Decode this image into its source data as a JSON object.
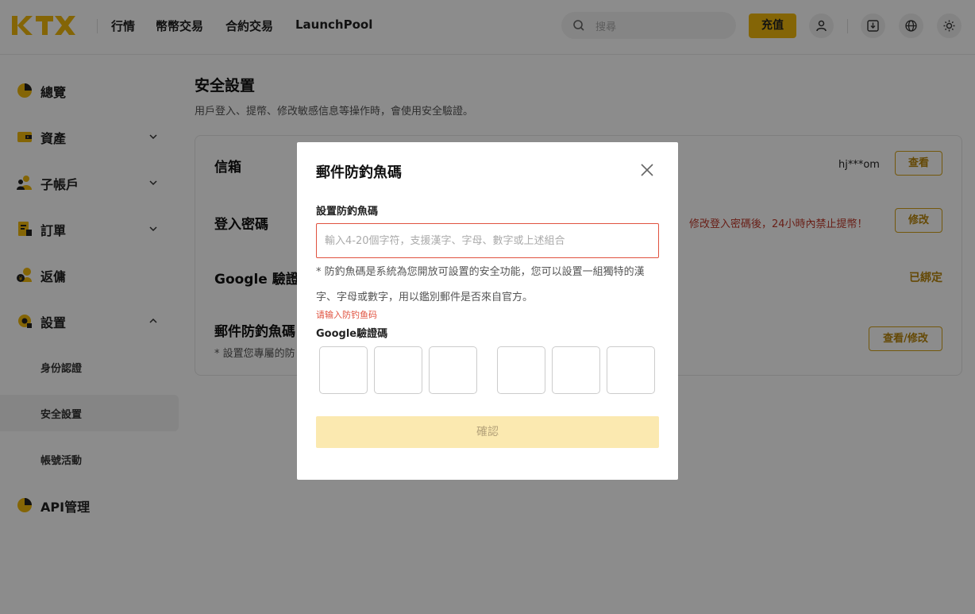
{
  "header": {
    "logo_text": "KTX",
    "nav": [
      "行情",
      "幣幣交易",
      "合約交易",
      "LaunchPool"
    ],
    "search_placeholder": "搜尋",
    "deposit_label": "充值",
    "icons": [
      "user-icon",
      "download-icon",
      "globe-icon",
      "theme-sun-icon"
    ]
  },
  "sidebar": {
    "items": [
      {
        "label": "總覽",
        "icon": "overview-icon"
      },
      {
        "label": "資產",
        "icon": "wallet-icon"
      },
      {
        "label": "子帳戶",
        "icon": "subaccount-icon"
      },
      {
        "label": "訂單",
        "icon": "orders-icon"
      },
      {
        "label": "返傭",
        "icon": "rebate-icon"
      },
      {
        "label": "設置",
        "icon": "settings-icon"
      }
    ],
    "sub_items": [
      "身份認證",
      "安全設置",
      "帳號活動"
    ],
    "api": {
      "label": "API管理",
      "icon": "api-icon"
    }
  },
  "main": {
    "title": "安全設置",
    "description": "用戶登入、提幣、修改敏感信息等操作時，會使用安全驗證。",
    "rows": {
      "email": {
        "title": "信箱",
        "value": "hj***om",
        "button": "查看"
      },
      "password": {
        "title": "登入密碼",
        "warning": "修改登入密碼後，24小時內禁止提幣！",
        "button": "修改"
      },
      "google": {
        "title": "Google 驗證",
        "status": "已綁定"
      },
      "phishing": {
        "title": "郵件防釣魚碼",
        "sub": "* 設置您專屬的防",
        "button": "查看/修改"
      }
    }
  },
  "modal": {
    "title": "郵件防釣魚碼",
    "field_label": "設置防釣魚碼",
    "input_placeholder": "輸入4-20個字符，支援漢字、字母、數字或上述組合",
    "input_value": "",
    "hint": "* 防釣魚碼是系統為您開放可設置的安全功能，您可以設置一組獨特的漢字、字母或數字，用以鑑別郵件是否來自官方。",
    "error": "请输入防钓鱼码",
    "google_label": "Google驗證碼",
    "confirm_label": "確認"
  },
  "colors": {
    "brand": "#f0b90b",
    "error": "#e0523f",
    "confirm_disabled": "#fbe9b0"
  }
}
